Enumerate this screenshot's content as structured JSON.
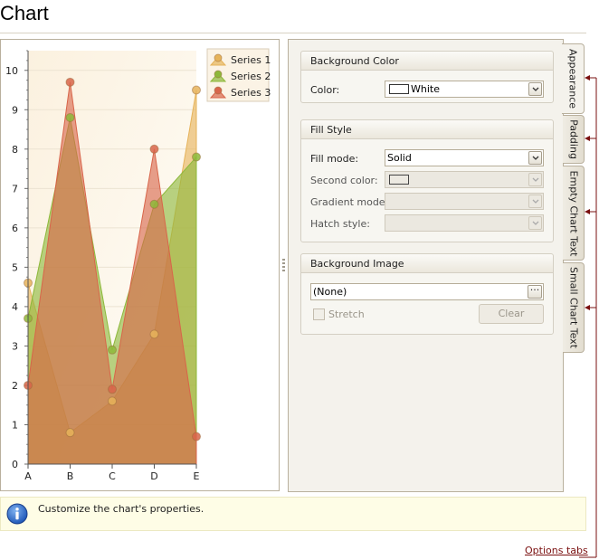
{
  "page": {
    "title": "Chart"
  },
  "chart_data": {
    "type": "area",
    "categories": [
      "A",
      "B",
      "C",
      "D",
      "E"
    ],
    "series": [
      {
        "name": "Series 1",
        "values": [
          4.6,
          0.8,
          1.6,
          3.3,
          9.5
        ],
        "color": "#e6b35a"
      },
      {
        "name": "Series 2",
        "values": [
          3.7,
          8.8,
          2.9,
          6.6,
          7.8
        ],
        "color": "#8db83a"
      },
      {
        "name": "Series 3",
        "values": [
          2.0,
          9.7,
          1.9,
          8.0,
          0.7
        ],
        "color": "#d8654a"
      }
    ],
    "ylim": [
      0,
      10.5
    ],
    "yticks": [
      "0",
      "1",
      "2",
      "3",
      "4",
      "5",
      "6",
      "7",
      "8",
      "9",
      "10"
    ],
    "grid": true,
    "legend_position": "top-right",
    "legend_icon": "pushpin-marker-icon"
  },
  "options": {
    "background_color": {
      "header": "Background Color",
      "color_label": "Color:",
      "color_value": "White",
      "swatch_color": "#ffffff"
    },
    "fill_style": {
      "header": "Fill Style",
      "fill_mode_label": "Fill mode:",
      "fill_mode_value": "Solid",
      "second_color_label": "Second color:",
      "gradient_mode_label": "Gradient mode:",
      "hatch_style_label": "Hatch style:"
    },
    "background_image": {
      "header": "Background Image",
      "value": "(None)",
      "ellipsis_label": "···",
      "stretch_label": "Stretch",
      "clear_label": "Clear"
    }
  },
  "tabs": [
    {
      "label": "Appearance",
      "active": true
    },
    {
      "label": "Padding",
      "active": false
    },
    {
      "label": "Empty Chart Text",
      "active": false
    },
    {
      "label": "Small Chart Text",
      "active": false
    }
  ],
  "info": {
    "icon": "info-icon",
    "text": "Customize the chart's properties."
  },
  "callout": {
    "label": "Options tabs",
    "color": "#7a1010"
  }
}
